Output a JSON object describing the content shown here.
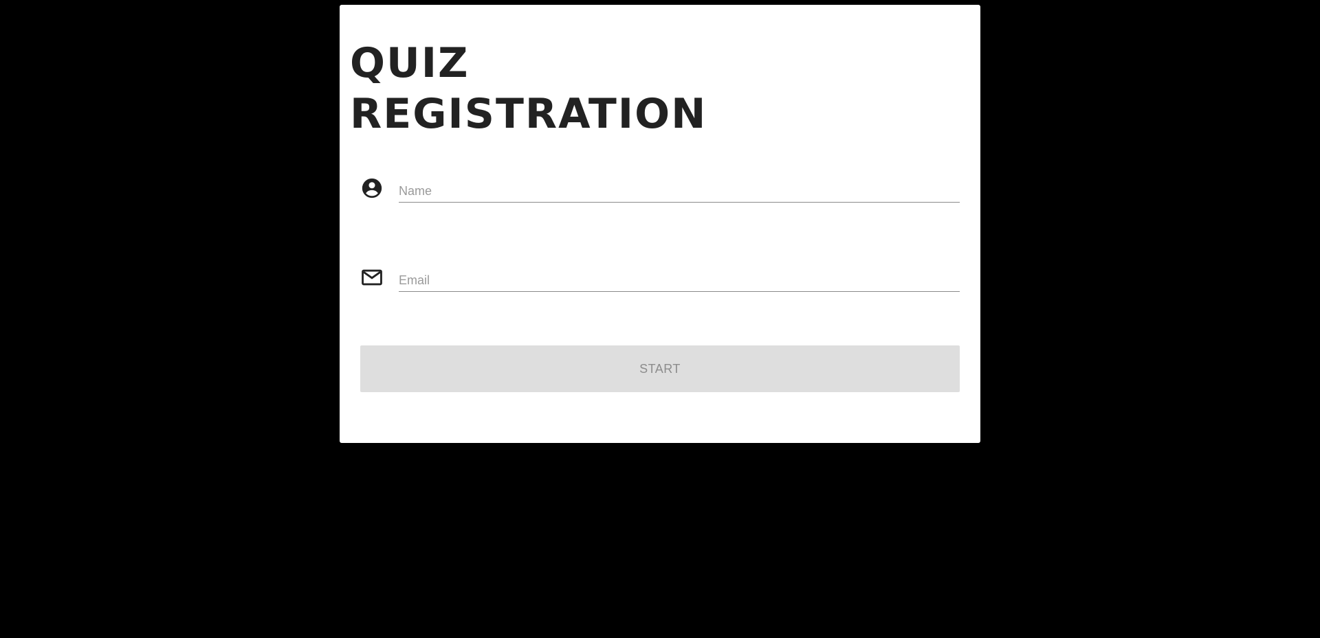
{
  "form": {
    "title_line1": "QUIZ",
    "title_line2": "REGISTRATION",
    "name_field": {
      "placeholder": "Name",
      "value": "",
      "icon": "account-circle-icon"
    },
    "email_field": {
      "placeholder": "Email",
      "value": "",
      "icon": "mail-icon"
    },
    "start_label": "START"
  },
  "colors": {
    "page_background": "#000000",
    "card_background": "#ffffff",
    "title_text": "#222222",
    "button_disabled_background": "#dedede",
    "button_disabled_text": "#8c8c8c",
    "placeholder_text": "#9a9a9a",
    "underline": "#8a8a8a"
  }
}
